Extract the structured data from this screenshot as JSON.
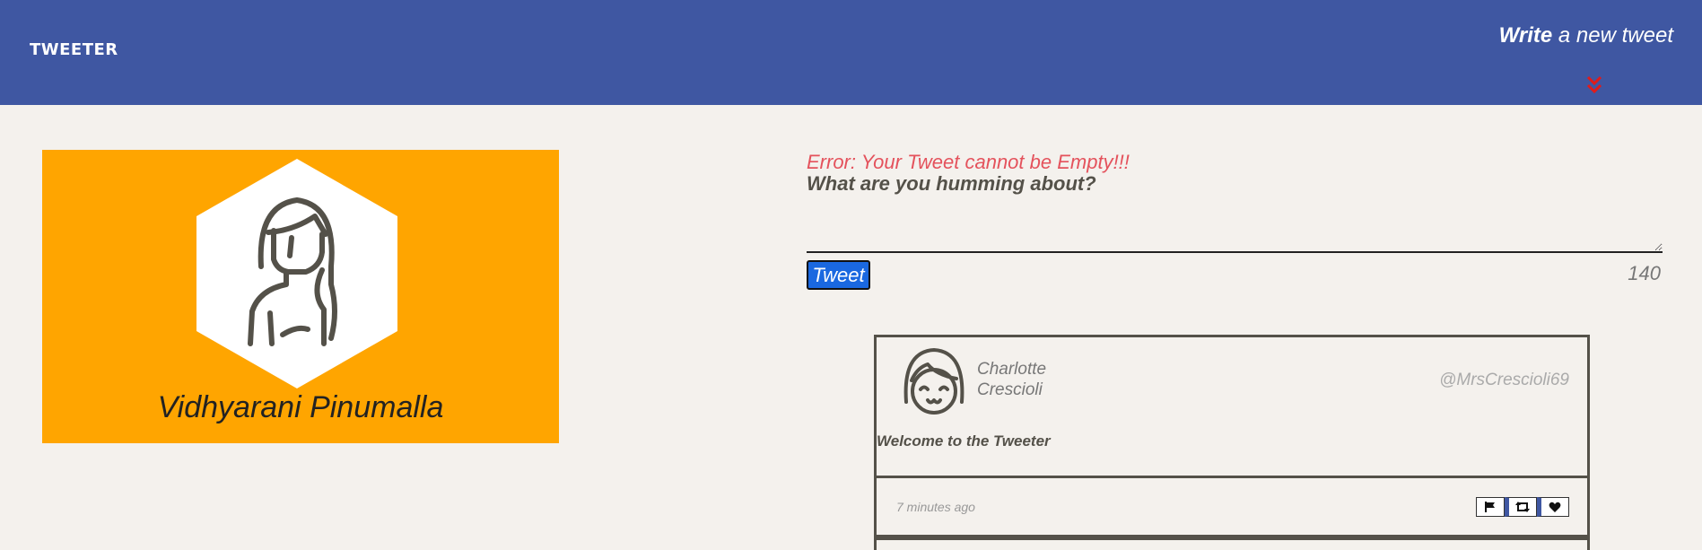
{
  "nav": {
    "brand": "TWEETER",
    "compose_bold": "Write",
    "compose_rest": " a new tweet"
  },
  "colors": {
    "nav_bg": "#3f57a2",
    "page_bg": "#f4f1ed",
    "profile_bg": "#ffa500",
    "error": "#e4525c",
    "tweet_button": "#1a68e0",
    "chevron": "#e01b1b"
  },
  "icons": {
    "nav_chevron": "double-chevron-down-icon",
    "profile_avatar": "woman-avatar-icon",
    "tweet_avatar": "girl-avatar-icon",
    "flag": "flag-icon",
    "retweet": "retweet-icon",
    "like": "heart-icon"
  },
  "profile": {
    "name": "Vidhyarani Pinumalla"
  },
  "composer": {
    "error": "Error: Your Tweet cannot be Empty!!!",
    "prompt": "What are you humming about?",
    "input_value": "",
    "button_label": "Tweet",
    "counter": "140"
  },
  "tweets": [
    {
      "author_name": "Charlotte Crescioli",
      "handle": "@MrsCrescioli69",
      "content": "Welcome to the Tweeter",
      "time": "7 minutes ago"
    }
  ]
}
